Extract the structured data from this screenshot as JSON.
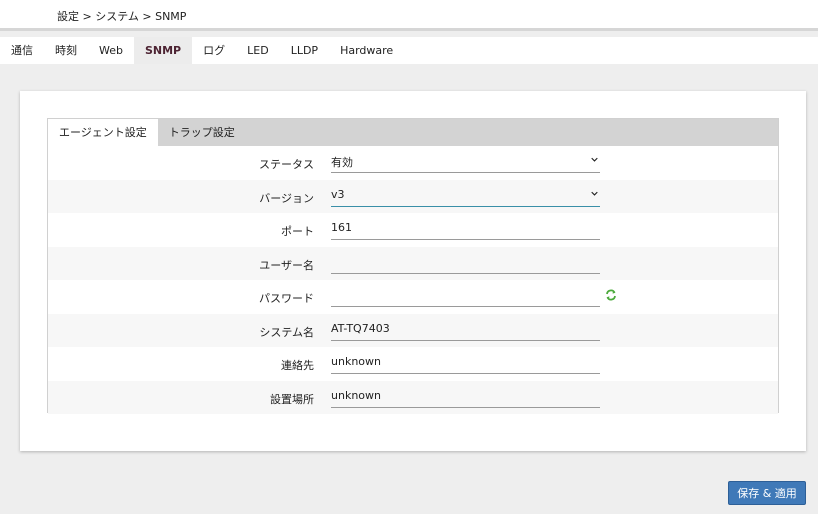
{
  "breadcrumb": "設定 > システム > SNMP",
  "tabs": [
    {
      "label": "通信"
    },
    {
      "label": "時刻"
    },
    {
      "label": "Web"
    },
    {
      "label": "SNMP"
    },
    {
      "label": "ログ"
    },
    {
      "label": "LED"
    },
    {
      "label": "LLDP"
    },
    {
      "label": "Hardware"
    }
  ],
  "active_tab": "SNMP",
  "subtabs": [
    {
      "label": "エージェント設定"
    },
    {
      "label": "トラップ設定"
    }
  ],
  "form": {
    "status": {
      "label": "ステータス",
      "value": "有効"
    },
    "version": {
      "label": "バージョン",
      "value": "v3"
    },
    "port": {
      "label": "ポート",
      "value": "161"
    },
    "username": {
      "label": "ユーザー名",
      "value": ""
    },
    "password": {
      "label": "パスワード",
      "value": ""
    },
    "system_name": {
      "label": "システム名",
      "value": "AT-TQ7403"
    },
    "contact": {
      "label": "連絡先",
      "value": "unknown"
    },
    "location": {
      "label": "設置場所",
      "value": "unknown"
    }
  },
  "save_button": "保存 & 適用",
  "colors": {
    "accent": "#3f79b8",
    "active_tab_text": "#4d2433",
    "focus_underline": "#3a8fa8",
    "refresh_icon": "#4caa3c"
  }
}
